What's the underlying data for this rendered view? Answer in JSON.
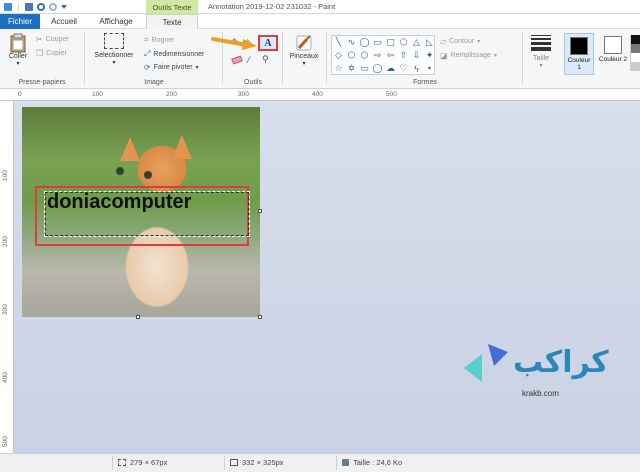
{
  "titlebar": {
    "context_tab_header": "Outils Texte",
    "title": "Annotation 2019-12-02 231032 - Paint"
  },
  "tabs": [
    {
      "label": "Fichier"
    },
    {
      "label": "Accueil"
    },
    {
      "label": "Affichage"
    },
    {
      "label": "Texte"
    }
  ],
  "ribbon": {
    "clipboard": {
      "paste_label": "Coller",
      "cut_label": "Couper",
      "copy_label": "Copier",
      "group_label": "Presse-papiers"
    },
    "image": {
      "select_label": "Sélectionner",
      "crop_label": "Rogner",
      "resize_label": "Redimensionner",
      "rotate_label": "Faire pivoter",
      "group_label": "Image"
    },
    "tools": {
      "group_label": "Outils",
      "text_tool_glyph": "A"
    },
    "brushes": {
      "label": "Pinceaux"
    },
    "shapes": {
      "outline_label": "Contour",
      "fill_label": "Remplissage",
      "group_label": "Formes"
    },
    "size": {
      "label": "Taille"
    },
    "colors": {
      "color1_label": "Couleur 1",
      "color2_label": "Couleur 2",
      "color1_value": "#000000",
      "color2_value": "#ffffff"
    }
  },
  "rulers": {
    "h_ticks": [
      "0",
      "100",
      "200",
      "300",
      "400",
      "500"
    ],
    "v_ticks": [
      "100",
      "200",
      "300",
      "400",
      "500"
    ]
  },
  "canvas": {
    "overlay_text": "doniacomputer"
  },
  "watermark": {
    "arabic_text": "كراكب",
    "url": "krakb.com"
  },
  "statusbar": {
    "selection_size": "279 × 67px",
    "image_size": "332 × 325px",
    "file_size": "Taille : 24,6 Ko"
  },
  "colors": {
    "accent": "#1f6ec1",
    "highlight_red": "#e03c3c",
    "arrow_orange": "#f0a020"
  }
}
